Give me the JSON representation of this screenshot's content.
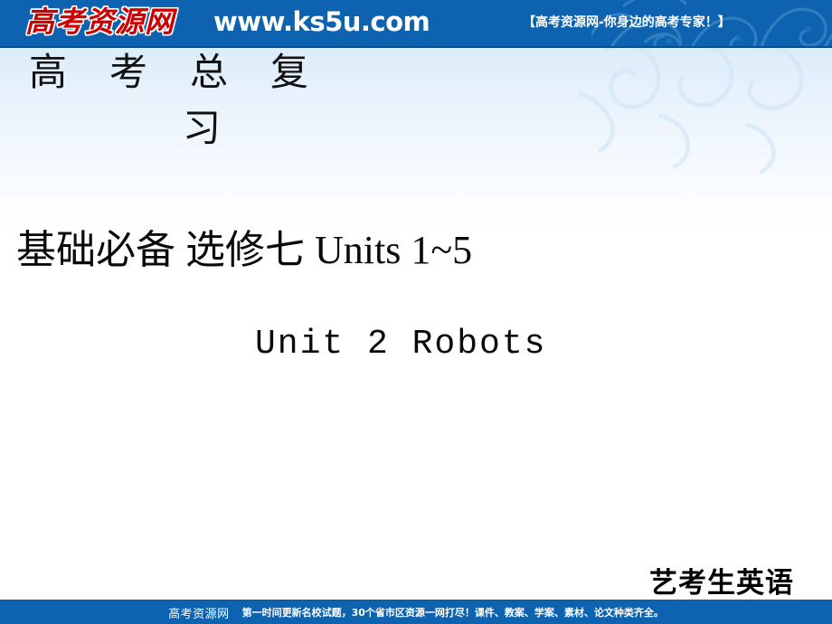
{
  "header": {
    "logo_text": "高考资源网",
    "url_text": "www.ks5u.com",
    "tagline": "【高考资源网-你身边的高考专家！】",
    "bar_color": "#0d63b0",
    "logo_color": "#cc0000"
  },
  "title": {
    "line1": "高考总复",
    "line2": "习",
    "full": "高考总复习"
  },
  "main": {
    "subject_line": "基础必备  选修七  Units 1~5",
    "unit_line": "Unit 2  Robots"
  },
  "course": {
    "label": "艺考生英语"
  },
  "footer": {
    "brand": "高考资源网",
    "slogan": "第一时间更新名校试题，30个省市区资源一网打尽！课件、教案、学案、素材、论文种类齐全。",
    "bar_color": "#0d63b0"
  }
}
